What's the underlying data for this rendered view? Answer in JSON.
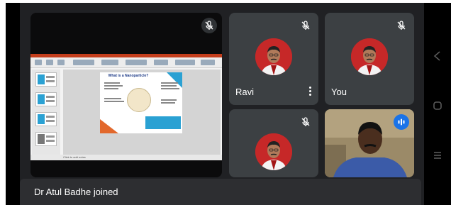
{
  "participants": {
    "ravi": {
      "name": "Ravi",
      "mic": "mic-off-icon"
    },
    "you": {
      "name": "You",
      "mic": "mic-off-icon"
    },
    "third": {
      "mic": "mic-off-icon"
    },
    "video": {
      "status": "speaking-icon"
    }
  },
  "presentation": {
    "slide_title": "What is a Nanoparticle?",
    "status_text": "Click to add notes"
  },
  "notification": {
    "text": "Dr Atul Badhe joined"
  },
  "colors": {
    "meet_background": "#202124",
    "tile_background": "#3c4043",
    "avatar_red": "#c62828",
    "speaking_blue": "#1a73e8",
    "toast_background": "#2d2e31"
  },
  "system_nav": [
    "back-icon",
    "home-icon",
    "recents-icon"
  ]
}
